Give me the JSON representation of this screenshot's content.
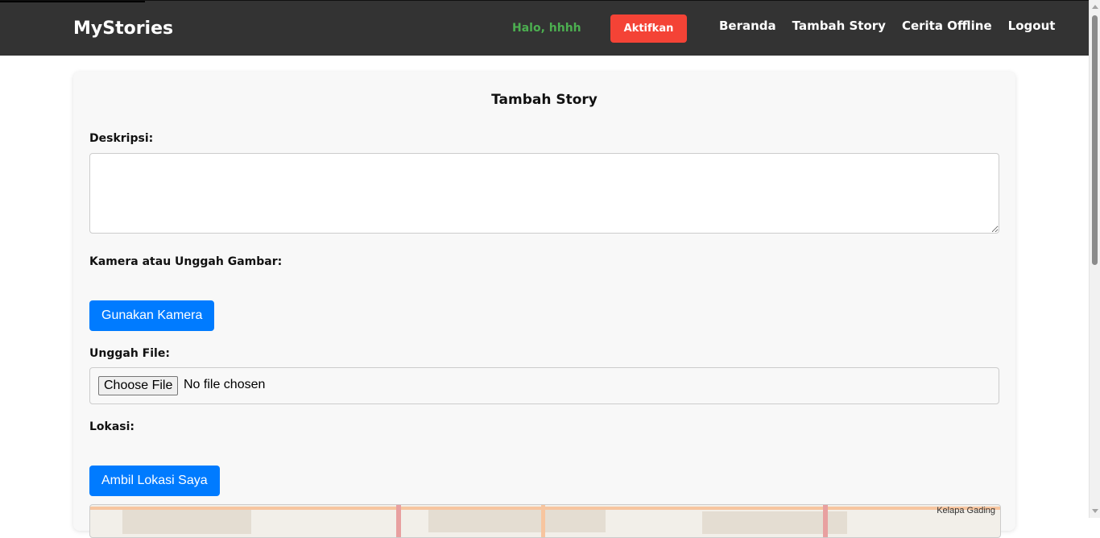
{
  "header": {
    "brand": "MyStories",
    "greeting": "Halo, hhhh",
    "activate_label": "Aktifkan",
    "nav": [
      "Beranda",
      "Tambah Story",
      "Cerita Offline",
      "Logout"
    ]
  },
  "form": {
    "title": "Tambah Story",
    "description_label": "Deskripsi:",
    "description_value": "",
    "camera_label": "Kamera atau Unggah Gambar:",
    "camera_button": "Gunakan Kamera",
    "upload_label": "Unggah File:",
    "choose_file": "Choose File",
    "no_file": "No file chosen",
    "location_label": "Lokasi:",
    "location_button": "Ambil Lokasi Saya"
  },
  "map": {
    "labels": [
      "Kelapa Gading"
    ]
  },
  "colors": {
    "header_bg": "#333333",
    "greeting": "#4caf50",
    "activate": "#f44336",
    "primary": "#007bff"
  }
}
